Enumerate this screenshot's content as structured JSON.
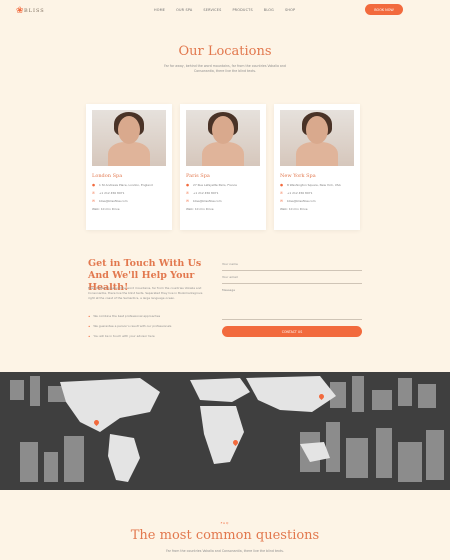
{
  "header": {
    "logo_text": "BLISS",
    "nav": [
      "HOME",
      "OUR SPA",
      "SERVICES",
      "PRODUCTS",
      "BLOG",
      "SHOP"
    ],
    "book_label": "BOOK NOW"
  },
  "locations": {
    "title": "Our Locations",
    "subtitle": "Far far away, behind the word mountains, far from the countries Vokalia and Consonantia, there live the blind texts.",
    "cards": [
      {
        "name": "London Spa",
        "address": "1 St Andrews Place, London, England",
        "phone": "+1 212 456 8971",
        "email": "bliss@blissflow.com",
        "directions": "Walk: 10 min Drive"
      },
      {
        "name": "Paris Spa",
        "address": "27 Rue Lafayette Paris, France",
        "phone": "+1 212 456 8971",
        "email": "bliss@blissflow.com",
        "directions": "Walk: 10 min Drive"
      },
      {
        "name": "New York Spa",
        "address": "8 Washington Square, New York, USA",
        "phone": "+1 212 456 8971",
        "email": "bliss@blissflow.com",
        "directions": "Walk: 10 min Drive"
      }
    ]
  },
  "contact": {
    "title": "Get in Touch With Us And We'll Help Your Health!",
    "text": "Even blistering behind the word mountains, far from the countries Vokalia and Consonantia, there live the blind texts. Separated they live in Bookmarksgrove right at the coast of the Semantics, a large language ocean.",
    "bullets": [
      "We combine the best professional approaches",
      "We guarantee a person’s result with our professionals",
      "You will be in touch with your advisor here"
    ],
    "form": {
      "name_placeholder": "Your name",
      "email_placeholder": "Your email",
      "message_placeholder": "Message",
      "send_label": "CONTACT US"
    }
  },
  "faq": {
    "kicker": "FAQ",
    "title": "The most common questions",
    "subtitle": "Far from the countries Vokalia and Consonantia, there live the blind texts."
  }
}
